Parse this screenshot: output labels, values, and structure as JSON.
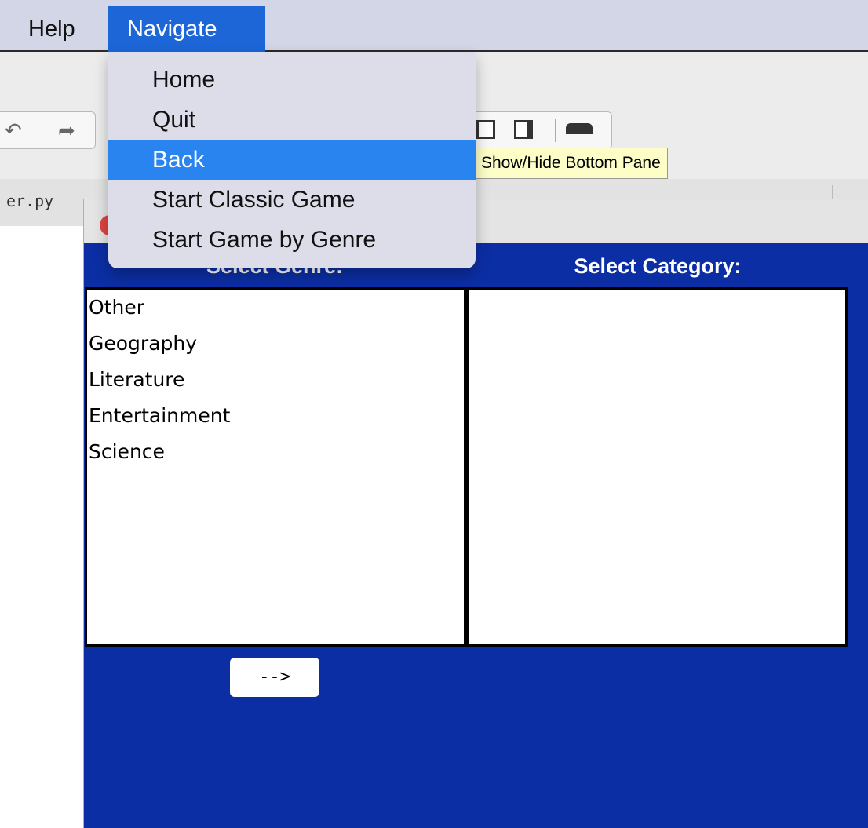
{
  "menubar": {
    "items": [
      {
        "label": "Help"
      },
      {
        "label": "Navigate"
      }
    ]
  },
  "navigate_menu": {
    "items": [
      {
        "label": "Home",
        "active": false
      },
      {
        "label": "Quit",
        "active": false
      },
      {
        "label": "Back",
        "active": true
      },
      {
        "label": "Start Classic Game",
        "active": false
      },
      {
        "label": "Start Game by Genre",
        "active": false
      }
    ]
  },
  "ide": {
    "tooltip": "Show/Hide Bottom Pane",
    "tab_label": "er.py",
    "undo_icon": "undo-icon",
    "redo_icon": "redo-icon"
  },
  "game_window": {
    "genre_label": "Select Genre:",
    "category_label": "Select Category:",
    "genres": [
      "Other",
      "Geography",
      "Literature",
      "Entertainment",
      "Science"
    ],
    "categories": [],
    "next_button": "-->"
  },
  "colors": {
    "window_background": "#0c2ea4",
    "menu_highlight": "#2a84f0",
    "menubar_active": "#1c66d8",
    "tooltip_background": "#fdfdc8"
  }
}
